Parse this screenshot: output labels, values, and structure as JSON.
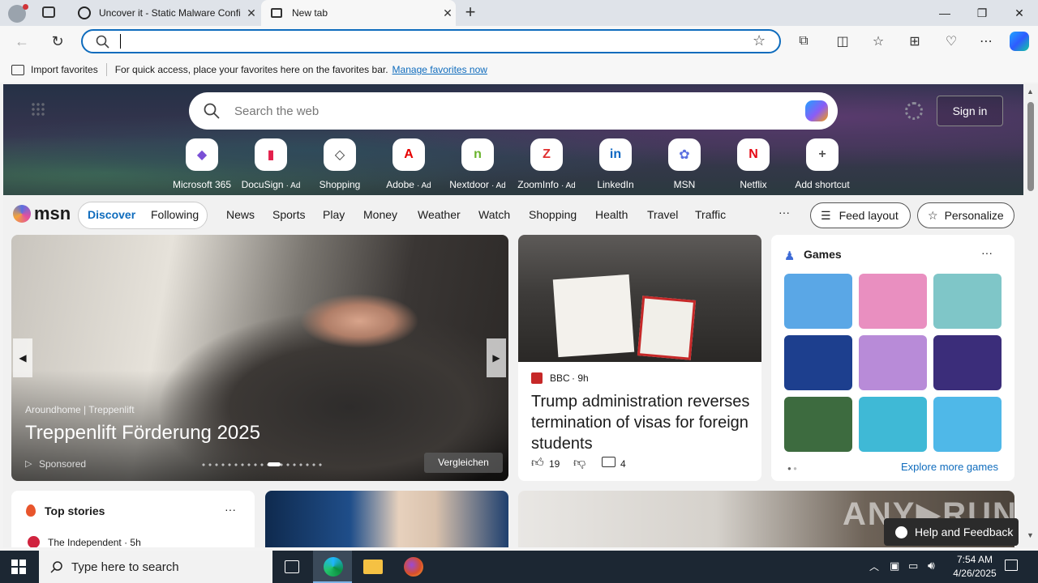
{
  "tabs": [
    {
      "title": "Uncover it - Static Malware Confi",
      "close": "✕"
    },
    {
      "title": "New tab",
      "close": "✕"
    }
  ],
  "new_tab": "+",
  "window": {
    "minimize": "—",
    "maximize": "❐",
    "close": "✕"
  },
  "toolbar": {
    "back": "←",
    "reload": "↻",
    "address_value": "",
    "star": "☆",
    "ext": "⧉",
    "split": "◫",
    "favorites": "☆",
    "collections": "⊞",
    "health": "♡",
    "more": "⋯"
  },
  "favbar": {
    "import_label": "Import favorites",
    "hint": "For quick access, place your favorites here on the favorites bar.",
    "manage_link": "Manage favorites now"
  },
  "ntp": {
    "search_placeholder": "Search the web",
    "sign_in": "Sign in",
    "shortcuts": [
      {
        "label": "Microsoft 365",
        "glyph": "◆",
        "color": "#7a4fd6"
      },
      {
        "label": "DocuSign",
        "ad": "· Ad",
        "glyph": "▮",
        "color": "#e3204b"
      },
      {
        "label": "Shopping",
        "glyph": "◇",
        "color": "#333333"
      },
      {
        "label": "Adobe",
        "ad": "· Ad",
        "glyph": "A",
        "color": "#e60000"
      },
      {
        "label": "Nextdoor",
        "ad": "· Ad",
        "glyph": "n",
        "color": "#6ab42d"
      },
      {
        "label": "ZoomInfo",
        "ad": "· Ad",
        "glyph": "Z",
        "color": "#e0302f"
      },
      {
        "label": "LinkedIn",
        "glyph": "in",
        "color": "#0a66c2"
      },
      {
        "label": "MSN",
        "glyph": "✿",
        "color": "#5a6fe0"
      },
      {
        "label": "Netflix",
        "glyph": "N",
        "color": "#e50914"
      },
      {
        "label": "Add shortcut",
        "glyph": "+",
        "color": "#555555"
      }
    ]
  },
  "msn": {
    "logo": "msn",
    "discover": "Discover",
    "following": "Following",
    "nav": [
      "News",
      "Sports",
      "Play",
      "Money",
      "Weather",
      "Watch",
      "Shopping",
      "Health",
      "Travel",
      "Traffic"
    ],
    "more": "···",
    "feed_layout": "Feed layout",
    "personalize": "Personalize"
  },
  "hero_card": {
    "source": "Aroundhome | Treppenlift",
    "title": "Treppenlift Förderung 2025",
    "sponsored": "Sponsored",
    "cta": "Vergleichen"
  },
  "news_card": {
    "source": "BBC",
    "age": "· 9h",
    "title": "Trump administration reverses termination of visas for foreign students",
    "likes": "19",
    "comments": "4"
  },
  "games": {
    "title": "Games",
    "more": "···",
    "explore": "Explore more games",
    "tiles": [
      {
        "color": "#5aa7e6"
      },
      {
        "color": "#e98fc0"
      },
      {
        "color": "#7fc6c8"
      },
      {
        "color": "#1d3f8e"
      },
      {
        "color": "#b88bd8"
      },
      {
        "color": "#3b2d7a"
      },
      {
        "color": "#3d6b3f"
      },
      {
        "color": "#3fb9d6"
      },
      {
        "color": "#4fb8e8"
      }
    ]
  },
  "top_stories": {
    "title": "Top stories",
    "more": "···",
    "source": "The Independent · 5h"
  },
  "help": "Help and Feedback",
  "taskbar": {
    "search_placeholder": "Type here to search",
    "time": "7:54 AM",
    "date": "4/26/2025"
  }
}
